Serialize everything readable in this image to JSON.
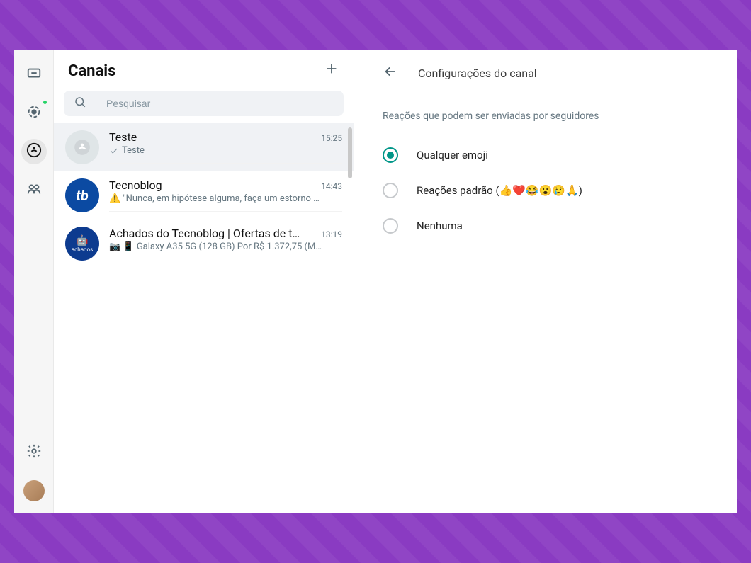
{
  "nav": {
    "chats_tooltip": "Conversas",
    "status_tooltip": "Status",
    "channels_tooltip": "Canais",
    "communities_tooltip": "Comunidades",
    "settings_tooltip": "Configurações",
    "profile_tooltip": "Perfil"
  },
  "channels": {
    "title": "Canais",
    "add_tooltip": "Criar canal",
    "search_placeholder": "Pesquisar",
    "items": [
      {
        "name": "Teste",
        "time": "15:25",
        "preview": "Teste",
        "avatar_kind": "teste",
        "selected": true,
        "tick": true
      },
      {
        "name": "Tecnoblog",
        "time": "14:43",
        "preview": "⚠️ \"Nunca, em hipótese alguma, faça um estorno …",
        "avatar_kind": "tb",
        "avatar_text": "tb",
        "selected": false,
        "tick": false
      },
      {
        "name": "Achados do Tecnoblog | Ofertas de t…",
        "time": "13:19",
        "preview": "📷 📱 Galaxy A35 5G (128 GB) Por R$ 1.372,75 (M…",
        "avatar_kind": "ach",
        "avatar_text": "achados",
        "selected": false,
        "tick": false
      }
    ]
  },
  "settings": {
    "title": "Configurações do canal",
    "section_label": "Reações que podem ser enviadas por seguidores",
    "options": [
      {
        "label": "Qualquer emoji",
        "checked": true
      },
      {
        "label": "Reações padrão (👍❤️😂😮😢🙏)",
        "checked": false
      },
      {
        "label": "Nenhuma",
        "checked": false
      }
    ]
  }
}
